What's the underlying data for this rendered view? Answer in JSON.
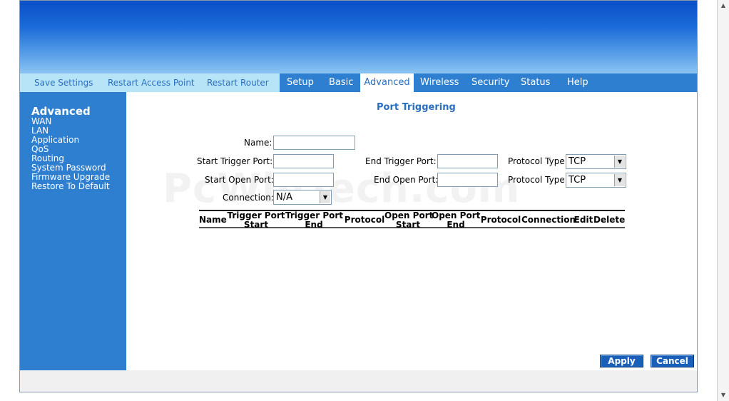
{
  "nav": {
    "links": [
      "Save Settings",
      "Restart Access Point",
      "Restart Router"
    ],
    "tabs": [
      "Setup",
      "Basic",
      "Advanced",
      "Wireless",
      "Security",
      "Status",
      "Help"
    ]
  },
  "sidebar": {
    "title": "Advanced",
    "items": [
      "WAN",
      "LAN",
      "Application",
      "QoS",
      "Routing",
      "System Password",
      "Firmware Upgrade",
      "Restore To Default"
    ]
  },
  "page": {
    "title": "Port Triggering",
    "watermark": "PcWinTech.com"
  },
  "form": {
    "name_label": "Name:",
    "name_value": "",
    "start_trigger_label": "Start Trigger Port:",
    "start_trigger_value": "",
    "end_trigger_label": "End Trigger Port:",
    "end_trigger_value": "",
    "protocol_type_label": "Protocol Type",
    "trigger_protocol": "TCP",
    "start_open_label": "Start Open Port:",
    "start_open_value": "",
    "end_open_label": "End Open Port:",
    "end_open_value": "",
    "open_protocol": "TCP",
    "connection_label": "Connection:",
    "connection_value": "N/A"
  },
  "table": {
    "headers": [
      [
        "Name"
      ],
      [
        "Trigger Port",
        "Start"
      ],
      [
        "Trigger Port",
        "End"
      ],
      [
        "Protocol"
      ],
      [
        "Open Port",
        "Start"
      ],
      [
        "Open Port",
        "End"
      ],
      [
        "Protocol"
      ],
      [
        "Connection"
      ],
      [
        "Edit"
      ],
      [
        "Delete"
      ]
    ],
    "rows": []
  },
  "buttons": {
    "apply": "Apply",
    "cancel": "Cancel"
  }
}
